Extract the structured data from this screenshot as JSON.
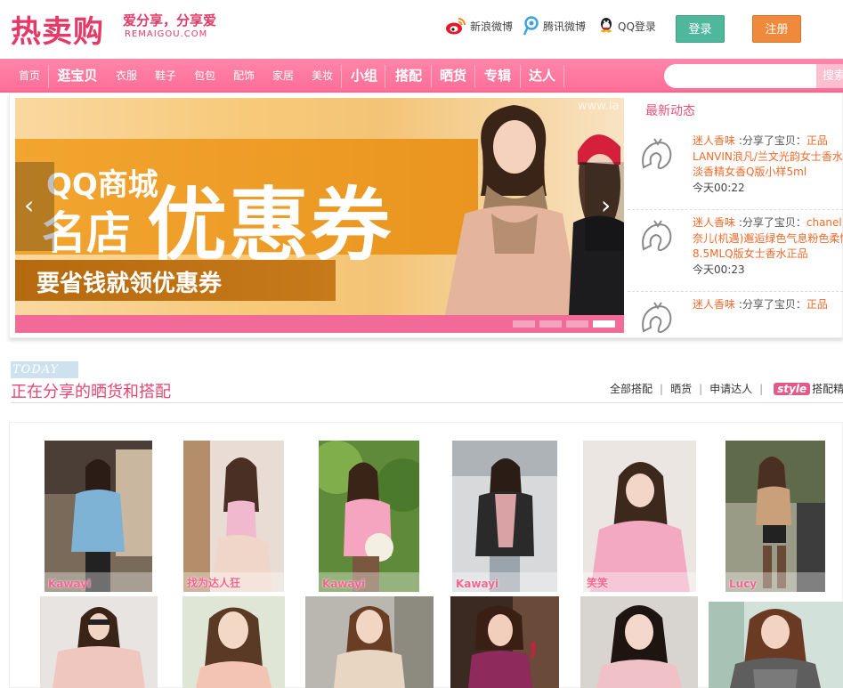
{
  "site": {
    "logo_text": "热卖购",
    "slogan": "爱分享，分享爱",
    "url_text": "REMAIGOU.COM"
  },
  "social": {
    "sina": "新浪微博",
    "tencent": "腾讯微博",
    "qq": "QQ登录"
  },
  "auth": {
    "login_label": "登录",
    "register_label": "注册"
  },
  "nav": {
    "items": [
      "首页",
      "逛宝贝",
      "衣服",
      "鞋子",
      "包包",
      "配饰",
      "家居",
      "美妆",
      "小组",
      "搭配",
      "晒货",
      "专辑",
      "达人"
    ],
    "search_button": "搜索",
    "search_placeholder": ""
  },
  "banner": {
    "line1": "QQ商城",
    "line2": "名店",
    "big": "优惠券",
    "sub": "要省钱就领优惠券",
    "watermark": "www.la"
  },
  "feed": {
    "title": "最新动态",
    "items": [
      {
        "user": "迷人香味",
        "action": " :分享了宝贝：",
        "item": "正品",
        "desc1": "LANVIN浪凡/兰文光韵女士香水",
        "desc2": "淡香精女香Q版小样5ml",
        "time": "今天00:22"
      },
      {
        "user": "迷人香味",
        "action": " :分享了宝贝：",
        "item": "chanel",
        "desc1": "奈儿(机遇)邂逅绿色气息粉色柔情",
        "desc2": "8.5MLQ版女士香水正品",
        "time": "今天00:23"
      },
      {
        "user": "迷人香味",
        "action": " :分享了宝贝：",
        "item": "正品",
        "desc1": "",
        "desc2": "",
        "time": ""
      }
    ]
  },
  "today": {
    "badge": "TODAY",
    "title": "正在分享的晒货和搭配",
    "links": [
      "全部搭配",
      "晒货",
      "申请达人"
    ],
    "style_badge": "style",
    "style_link": "搭配精选"
  },
  "gallery": {
    "row1": [
      {
        "name": "Kawayi"
      },
      {
        "name": "找为达人狂"
      },
      {
        "name": "Kawayi"
      },
      {
        "name": "Kawayi"
      },
      {
        "name": "笑笑"
      },
      {
        "name": "Lucy"
      }
    ]
  },
  "colors": {
    "brand_pink": "#e33a68",
    "nav_pink": "#ff7aa0",
    "login_green": "#4fb79c",
    "register_orange": "#ef8a3c",
    "feed_orange": "#f06a2a"
  }
}
